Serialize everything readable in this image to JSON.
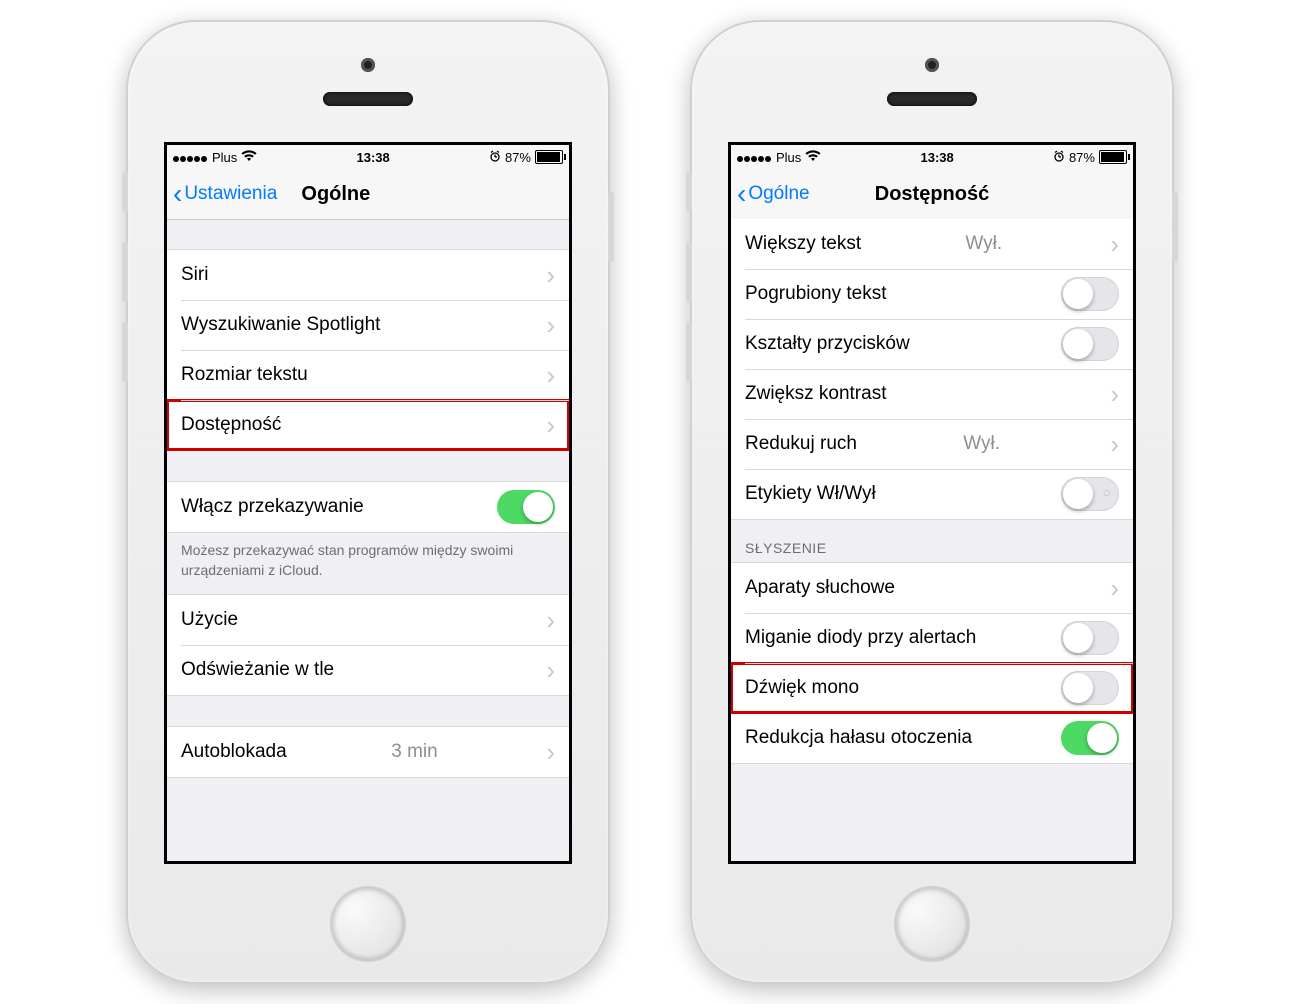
{
  "status": {
    "carrier": "Plus",
    "time": "13:38",
    "battery_pct": "87%"
  },
  "phone1": {
    "back": "Ustawienia",
    "title": "Ogólne",
    "group1": [
      "Siri",
      "Wyszukiwanie Spotlight",
      "Rozmiar tekstu",
      "Dostępność"
    ],
    "handoff": {
      "label": "Włącz przekazywanie",
      "note": "Możesz przekazywać stan programów między swoimi urządzeniami z iCloud."
    },
    "group2": [
      "Użycie",
      "Odświeżanie w tle"
    ],
    "autolock": {
      "label": "Autoblokada",
      "value": "3 min"
    }
  },
  "phone2": {
    "back": "Ogólne",
    "title": "Dostępność",
    "larger_text": {
      "label": "Większy tekst",
      "value": "Wył."
    },
    "bold_text": "Pogrubiony tekst",
    "button_shapes": "Kształty przycisków",
    "increase_contrast": "Zwiększ kontrast",
    "reduce_motion": {
      "label": "Redukuj ruch",
      "value": "Wył."
    },
    "onoff_labels": "Etykiety Wł/Wył",
    "section_hearing": "SŁYSZENIE",
    "hearing_aids": "Aparaty słuchowe",
    "led_flash": "Miganie diody przy alertach",
    "mono_audio": "Dźwięk mono",
    "noise_cancel": "Redukcja hałasu otoczenia"
  }
}
